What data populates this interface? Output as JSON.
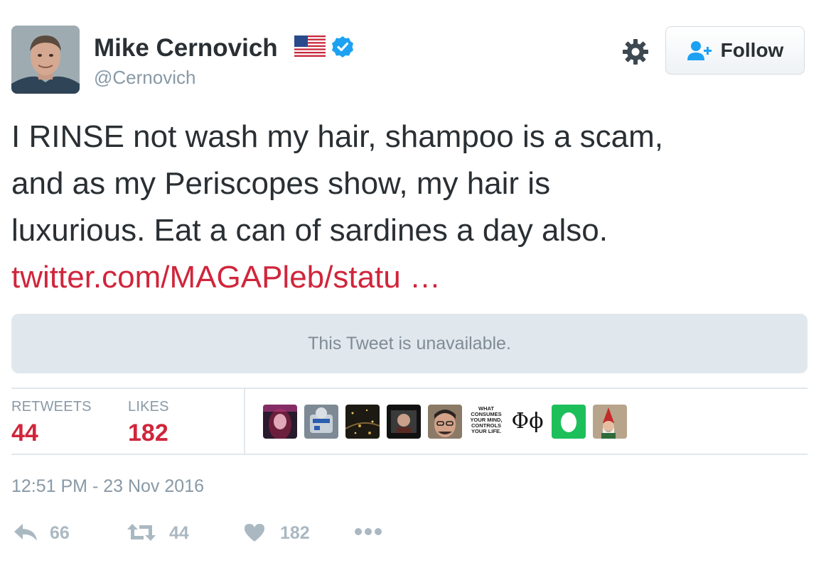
{
  "user": {
    "name": "Mike Cernovich",
    "handle": "@Cernovich",
    "flag_icon": "us-flag-icon",
    "verified_icon": "verified-badge-icon"
  },
  "header": {
    "settings_icon": "gear-icon",
    "follow_label": "Follow"
  },
  "tweet": {
    "text_lines": [
      "I RINSE not wash my hair, shampoo is a scam,",
      "and as my Periscopes show, my hair is",
      "luxurious. Eat a can of sardines a day also."
    ],
    "link": "twitter.com/MAGAPleb/statu …"
  },
  "quoted": {
    "unavailable_text": "This Tweet is unavailable."
  },
  "stats": {
    "retweets_label": "RETWEETS",
    "retweets_value": "44",
    "likes_label": "LIKES",
    "likes_value": "182"
  },
  "likers": {
    "text_avatar_lines": [
      "WHAT",
      "CONSUMES",
      "YOUR MIND,",
      "CONTROLS",
      "YOUR LIFE."
    ],
    "symbol_avatar": "Φϕ"
  },
  "timestamp": "12:51 PM - 23 Nov 2016",
  "actions": {
    "reply_count": "66",
    "retweet_count": "44",
    "like_count": "182"
  },
  "colors": {
    "accent": "#d0253b",
    "muted": "#8899a6",
    "verified_blue": "#1da1f2"
  }
}
